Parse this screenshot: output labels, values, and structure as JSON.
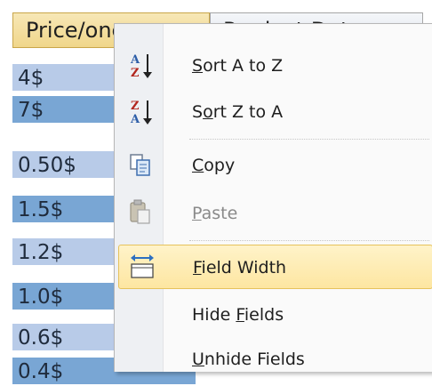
{
  "columns": {
    "price_header": "Price/one",
    "date_header": "Product Date"
  },
  "rows": [
    "4$",
    "7$",
    "0.50$",
    "1.5$",
    "1.2$",
    "1.0$",
    "0.6$",
    "0.4$"
  ],
  "menu": {
    "sort_az": {
      "pre": "",
      "key": "S",
      "post": "ort A to Z"
    },
    "sort_za": {
      "pre": "S",
      "key": "o",
      "post": "rt Z to A"
    },
    "copy": {
      "pre": "",
      "key": "C",
      "post": "opy"
    },
    "paste": {
      "pre": "",
      "key": "P",
      "post": "aste"
    },
    "field_width": {
      "pre": "",
      "key": "F",
      "post": "ield Width"
    },
    "hide_fields": {
      "pre": "Hide ",
      "key": "F",
      "post": "ields"
    },
    "unhide_fields": {
      "pre": "",
      "key": "U",
      "post": "nhide Fields"
    }
  },
  "icons": {
    "sort_az": "sort-ascending-icon",
    "sort_za": "sort-descending-icon",
    "copy": "copy-icon",
    "paste": "paste-icon",
    "field_width": "field-width-icon"
  },
  "colors": {
    "row_light": "#b8cbe8",
    "row_dark": "#79a6d4",
    "highlight": "#fde6a1",
    "selected_header": "#f0d68a"
  }
}
